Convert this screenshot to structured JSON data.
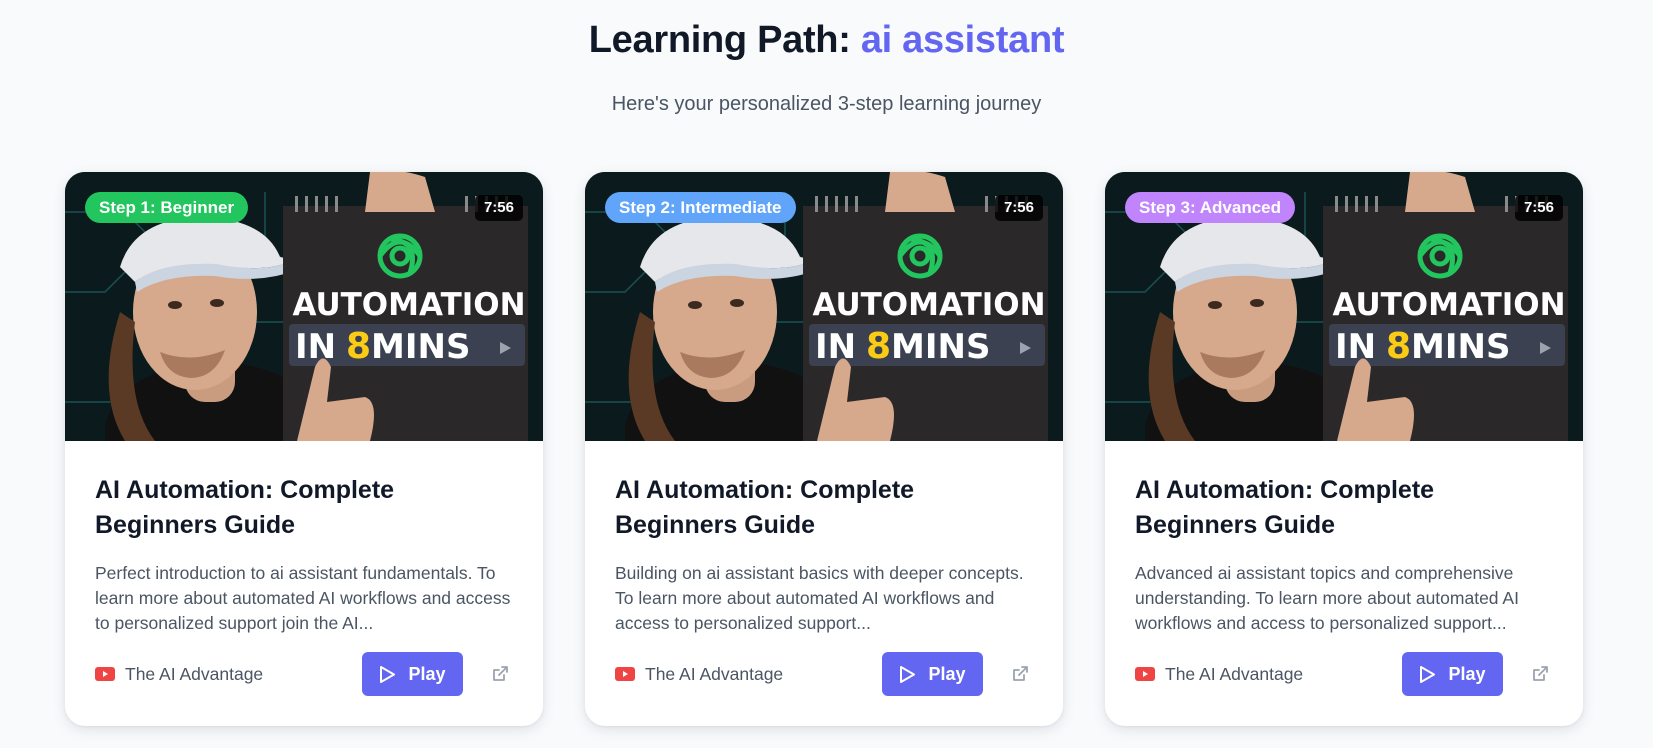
{
  "header": {
    "title_prefix": "Learning Path: ",
    "title_topic": "ai assistant",
    "subtitle": "Here's your personalized 3-step learning journey"
  },
  "colors": {
    "accent": "#6366f1",
    "step1": "#22c55e",
    "step2": "#60a5fa",
    "step3": "#c084fc",
    "youtube": "#ef4444"
  },
  "cards": [
    {
      "step_label": "Step 1: Beginner",
      "duration": "7:56",
      "thumb_line1": "AUTOMATION",
      "thumb_in": "IN",
      "thumb_num": "8",
      "thumb_mins": "MINS",
      "title": "AI Automation: Complete Beginners Guide",
      "description": "Perfect introduction to ai assistant fundamentals. To learn more about automated AI workflows and access to personalized support join the AI...",
      "channel": "The AI Advantage",
      "play_label": "Play"
    },
    {
      "step_label": "Step 2: Intermediate",
      "duration": "7:56",
      "thumb_line1": "AUTOMATION",
      "thumb_in": "IN",
      "thumb_num": "8",
      "thumb_mins": "MINS",
      "title": "AI Automation: Complete Beginners Guide",
      "description": "Building on ai assistant basics with deeper concepts. To learn more about automated AI workflows and access to personalized support...",
      "channel": "The AI Advantage",
      "play_label": "Play"
    },
    {
      "step_label": "Step 3: Advanced",
      "duration": "7:56",
      "thumb_line1": "AUTOMATION",
      "thumb_in": "IN",
      "thumb_num": "8",
      "thumb_mins": "MINS",
      "title": "AI Automation: Complete Beginners Guide",
      "description": "Advanced ai assistant topics and comprehensive understanding. To learn more about automated AI workflows and access to personalized support...",
      "channel": "The AI Advantage",
      "play_label": "Play"
    }
  ]
}
